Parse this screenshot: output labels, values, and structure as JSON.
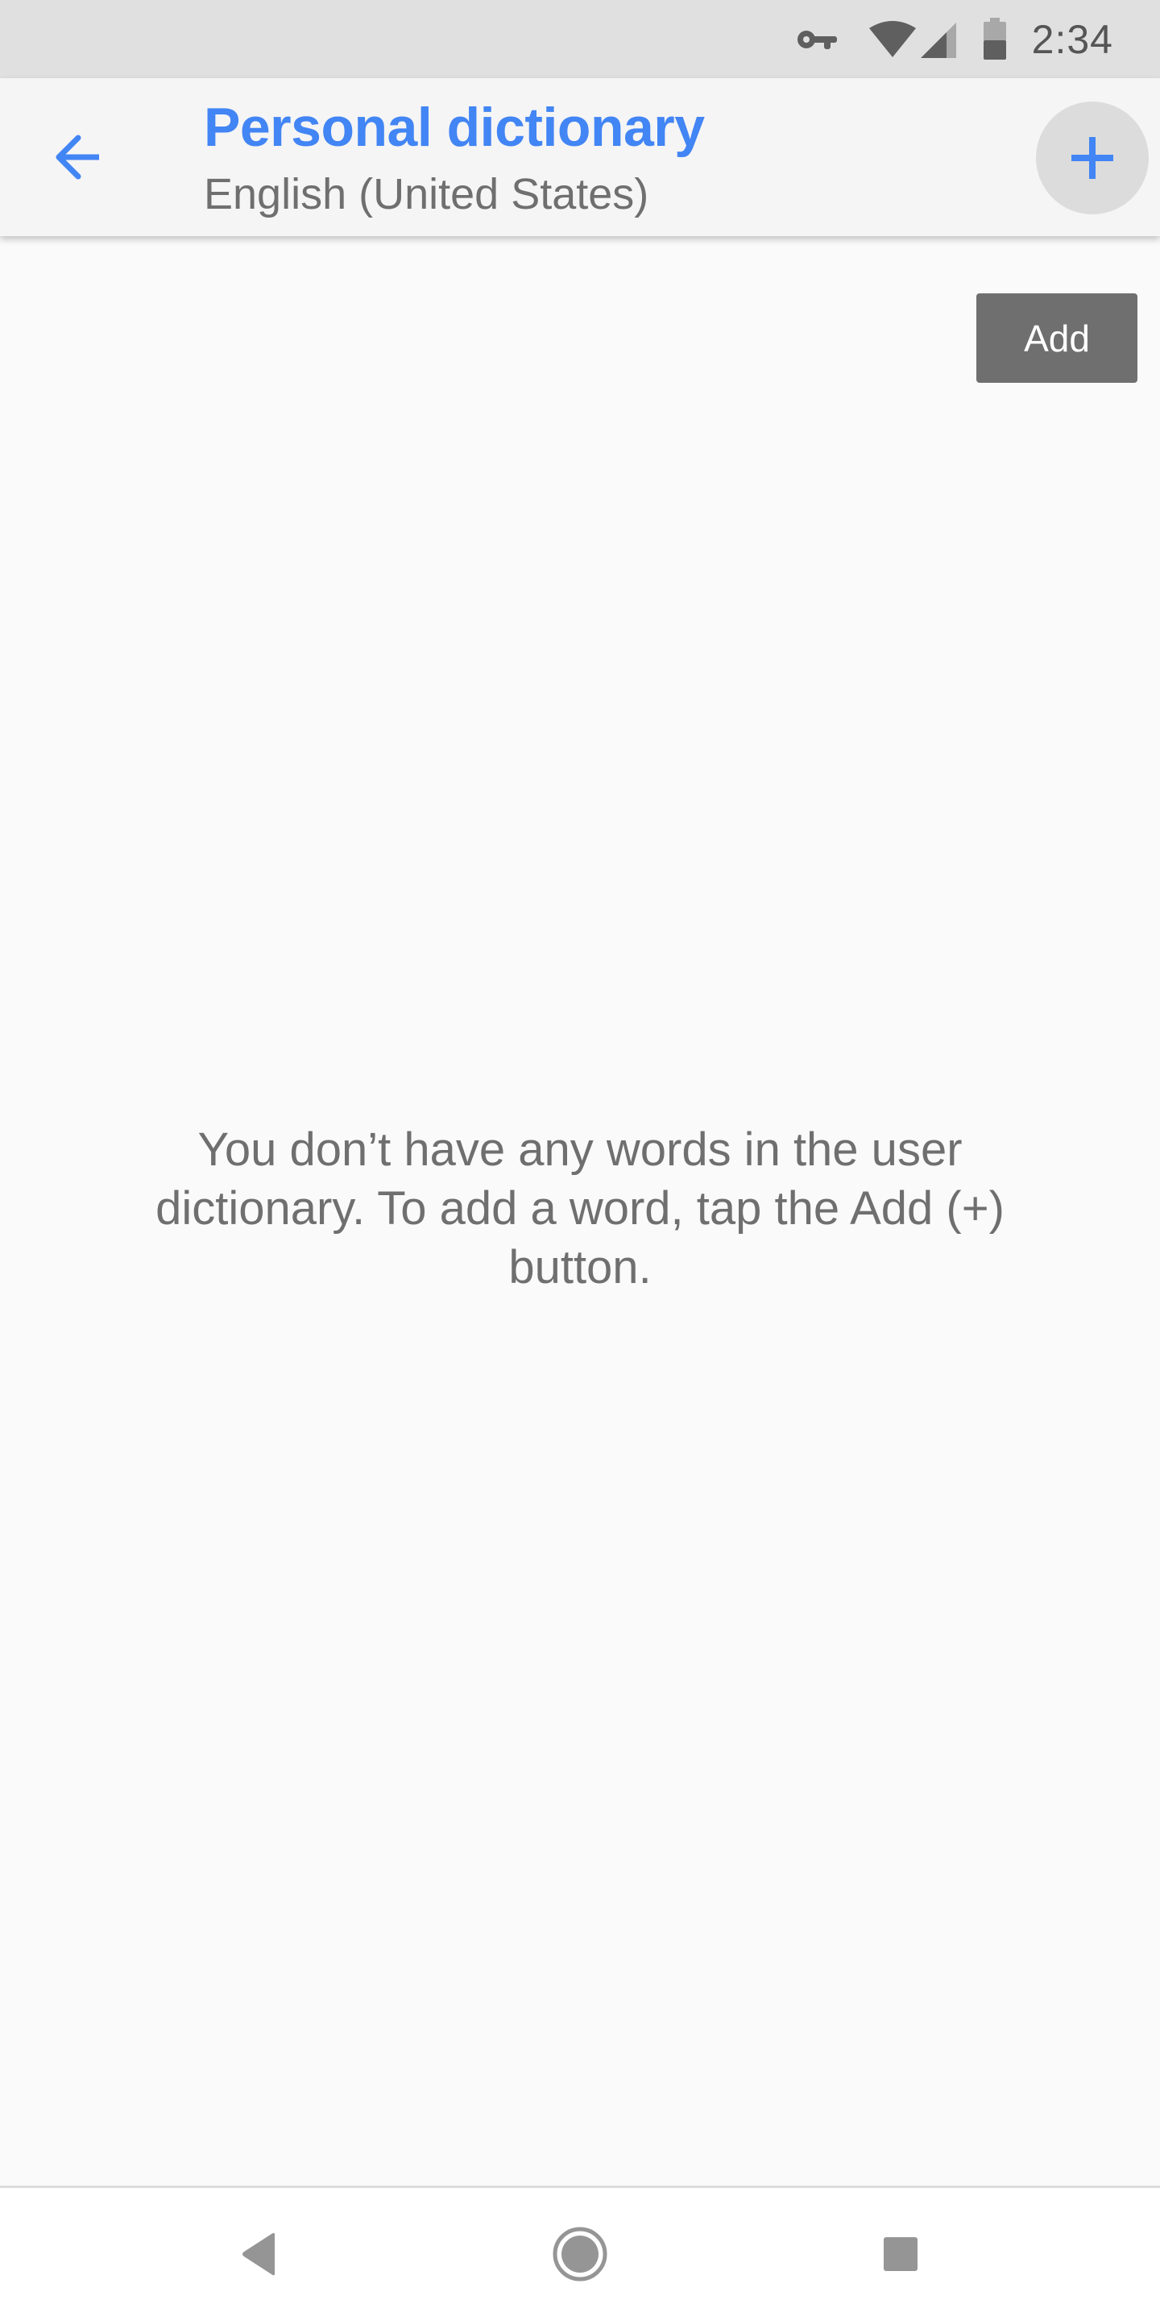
{
  "status_bar": {
    "time": "2:34",
    "icons": [
      "vpn-key-icon",
      "wifi-icon",
      "cell-signal-icon",
      "battery-icon"
    ]
  },
  "app_bar": {
    "back_icon": "arrow-back-icon",
    "title": "Personal dictionary",
    "subtitle": "English (United States)",
    "fab_icon": "plus-icon",
    "accent_color": "#4285f4"
  },
  "main": {
    "add_button_label": "Add",
    "empty_message": "You don’t have any words in the user dictionary. To add a word, tap the Add (+) button."
  },
  "nav_bar": {
    "buttons": [
      "back",
      "home",
      "overview"
    ]
  }
}
